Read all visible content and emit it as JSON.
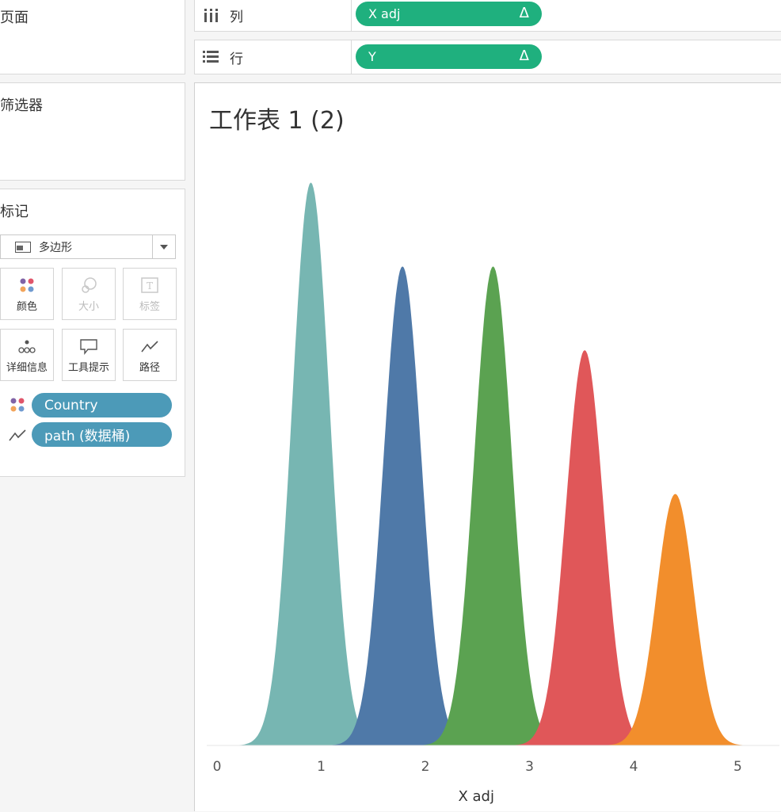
{
  "pages": {
    "title": "页面"
  },
  "filters": {
    "title": "筛选器"
  },
  "marks": {
    "title": "标记",
    "type_label": "多边形",
    "buttons": {
      "color": "颜色",
      "size": "大小",
      "label": "标签",
      "detail": "详细信息",
      "tooltip": "工具提示",
      "path": "路径"
    },
    "pills": {
      "color": "Country",
      "path": "path (数据桶)"
    }
  },
  "shelves": {
    "columns": {
      "label": "列",
      "pill": "X adj",
      "symbol": "Δ"
    },
    "rows": {
      "label": "行",
      "pill": "Y",
      "symbol": "Δ"
    }
  },
  "sheet": {
    "title": "工作表 1 (2)"
  },
  "colors": {
    "teal": "#77b6b2",
    "blue": "#4f79a8",
    "green": "#5ba251",
    "red": "#e05759",
    "orange": "#f28e2c",
    "pill_green": "#1fb07e",
    "pill_blue": "#4c9ab8"
  },
  "chart_data": {
    "type": "area",
    "xlabel": "X adj",
    "ylabel": "",
    "x_ticks": [
      0,
      1,
      2,
      3,
      4,
      5
    ],
    "xlim": [
      -0.1,
      5.4
    ],
    "ylim": [
      0,
      1.0
    ],
    "series": [
      {
        "center": 0.9,
        "peak": 0.94,
        "color": "#77b6b2"
      },
      {
        "center": 1.78,
        "peak": 0.8,
        "color": "#4f79a8"
      },
      {
        "center": 2.65,
        "peak": 0.8,
        "color": "#5ba251"
      },
      {
        "center": 3.53,
        "peak": 0.66,
        "color": "#e05759"
      },
      {
        "center": 4.4,
        "peak": 0.42,
        "color": "#f28e2c"
      }
    ]
  }
}
